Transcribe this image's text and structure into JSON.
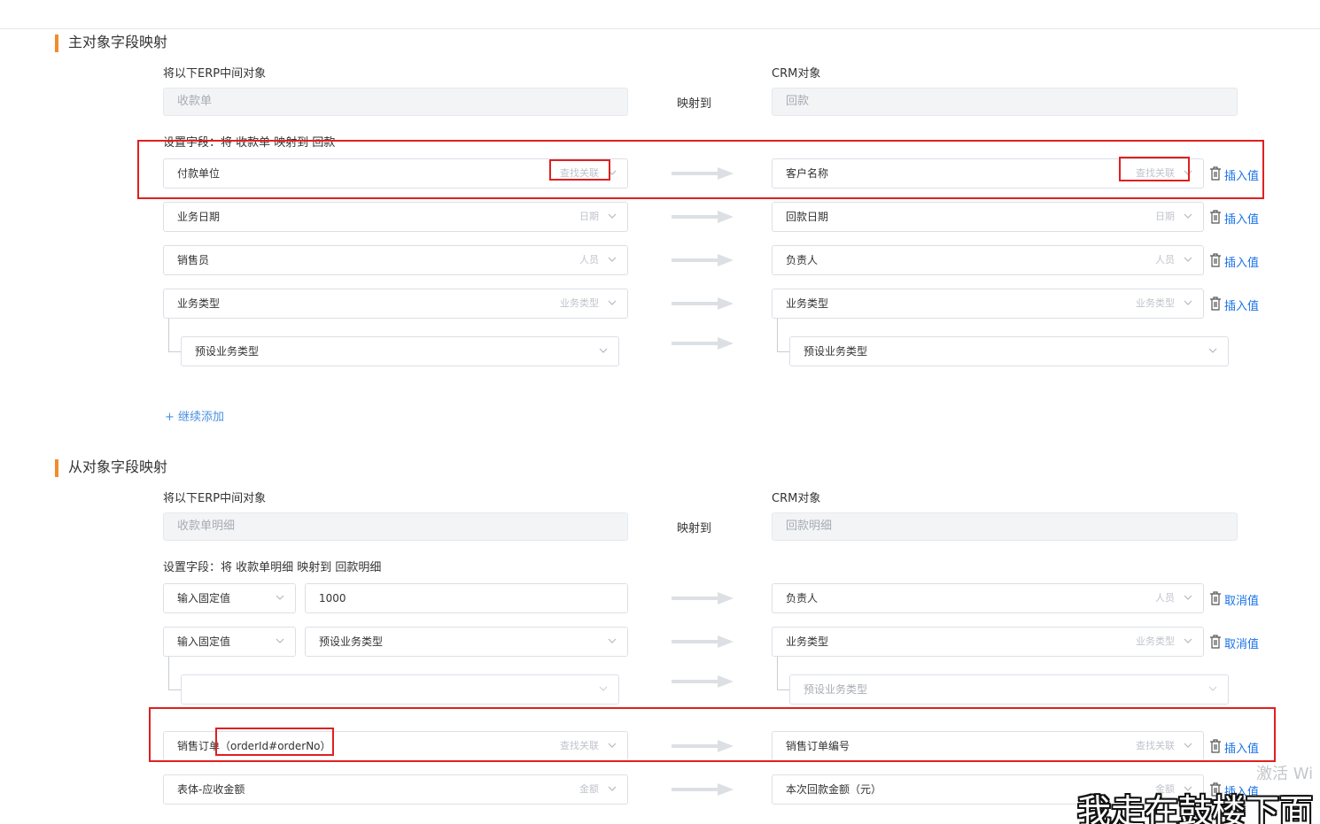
{
  "main_section": {
    "title": "主对象字段映射",
    "erp_label": "将以下ERP中间对象",
    "crm_label": "CRM对象",
    "erp_object": "收款单",
    "maps_to": "映射到",
    "crm_object": "回款",
    "set_fields_label": "设置字段：将 收款单 映射到 回款",
    "rows": [
      {
        "left_field": "付款单位",
        "left_type": "查找关联",
        "right_field": "客户名称",
        "right_type": "查找关联",
        "action": "插入值"
      },
      {
        "left_field": "业务日期",
        "left_type": "日期",
        "right_field": "回款日期",
        "right_type": "日期",
        "action": "插入值"
      },
      {
        "left_field": "销售员",
        "left_type": "人员",
        "right_field": "负责人",
        "right_type": "人员",
        "action": "插入值"
      },
      {
        "left_field": "业务类型",
        "left_type": "业务类型",
        "right_field": "业务类型",
        "right_type": "业务类型",
        "action": "插入值"
      }
    ],
    "sub_row": {
      "left": "预设业务类型",
      "right": "预设业务类型"
    },
    "add_more": "+ 继续添加"
  },
  "detail_section": {
    "title": "从对象字段映射",
    "erp_label": "将以下ERP中间对象",
    "crm_label": "CRM对象",
    "erp_object": "收款单明细",
    "maps_to": "映射到",
    "crm_object": "回款明细",
    "set_fields_label": "设置字段：将 收款单明细 映射到 回款明细",
    "fixed_rows": [
      {
        "mode": "输入固定值",
        "value": "1000",
        "right_field": "负责人",
        "right_type": "人员",
        "action": "取消值"
      },
      {
        "mode": "输入固定值",
        "value": "预设业务类型",
        "right_field": "业务类型",
        "right_type": "业务类型",
        "action": "取消值"
      }
    ],
    "sub_row": {
      "left": "",
      "right": "预设业务类型"
    },
    "rows": [
      {
        "left_field": "销售订单（orderId#orderNo）",
        "left_type": "查找关联",
        "right_field": "销售订单编号",
        "right_type": "查找关联",
        "action": "插入值"
      },
      {
        "left_field": "表体-应收金额",
        "left_type": "金额",
        "right_field": "本次回款金额（元）",
        "right_type": "金额",
        "action": "插入值"
      }
    ]
  },
  "overlay": {
    "watermark": "激活 Wi",
    "subtitle": "我走在鼓楼下面 汽"
  },
  "colors": {
    "accent_bar": "#f08c2b",
    "link": "#1a73e8",
    "highlight": "#e02020"
  }
}
